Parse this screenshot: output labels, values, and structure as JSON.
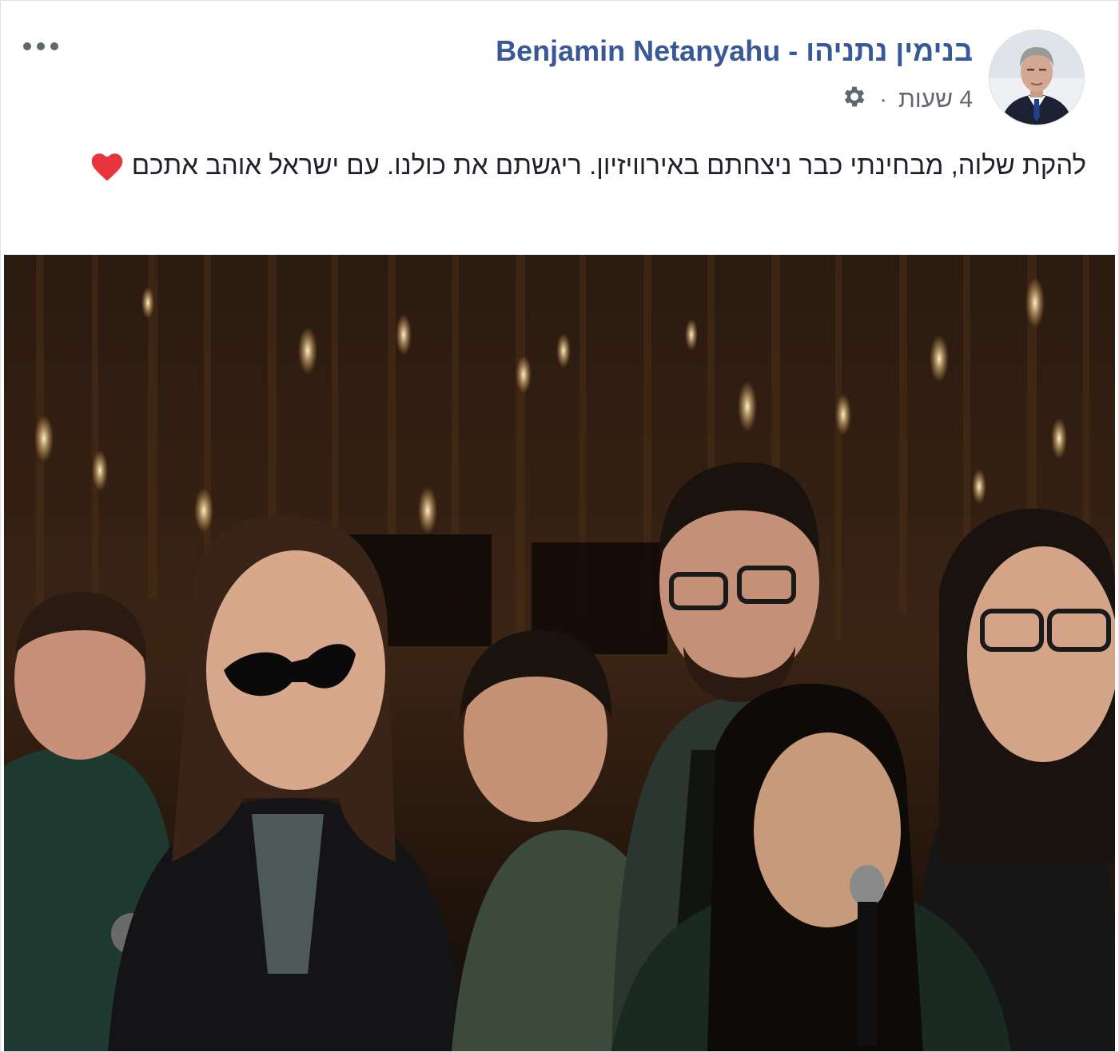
{
  "post": {
    "author_name": "Benjamin Netanyahu - בנימין נתניהו",
    "timestamp": "4 שעות",
    "separator": "·",
    "privacy_icon": "gear-icon",
    "text": "להקת שלוה, מבחינתי כבר ניצחתם באירוויזיון. ריגשתם את כולנו. עם ישראל אוהב אתכם",
    "emoji": "heart-icon",
    "more_icon": "more-options-icon"
  },
  "colors": {
    "author_link": "#385898",
    "meta_text": "#606770",
    "body_text": "#1d2129",
    "heart": "#e8343c"
  }
}
